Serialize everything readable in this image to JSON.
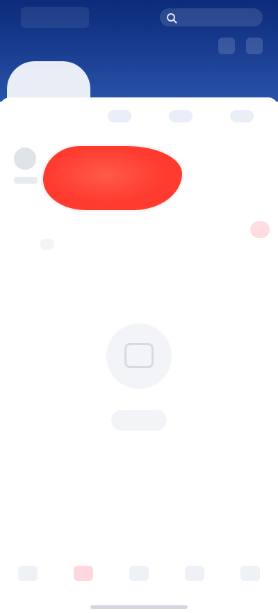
{
  "header": {
    "logo_text": "",
    "search_placeholder": "",
    "icons": [
      "scan-icon",
      "message-icon"
    ]
  },
  "quick_links": [
    {
      "label": ""
    },
    {
      "label": ""
    },
    {
      "label": ""
    }
  ],
  "promo": {
    "label": ""
  },
  "tabs": [
    {
      "label": "",
      "active": false
    },
    {
      "label": "",
      "active": true
    },
    {
      "label": "",
      "active": false
    }
  ],
  "tab_badge": "",
  "empty_state": {
    "title": "",
    "description": "",
    "action_label": ""
  },
  "bottom_nav": [
    {
      "label": "",
      "active": false
    },
    {
      "label": "",
      "active": true
    },
    {
      "label": "",
      "active": false
    },
    {
      "label": "",
      "active": false
    },
    {
      "label": "",
      "active": false
    }
  ],
  "colors": {
    "header_blue": "#1b3f93",
    "promo_red": "#ff3b30",
    "accent_pink": "#e43a5b"
  }
}
